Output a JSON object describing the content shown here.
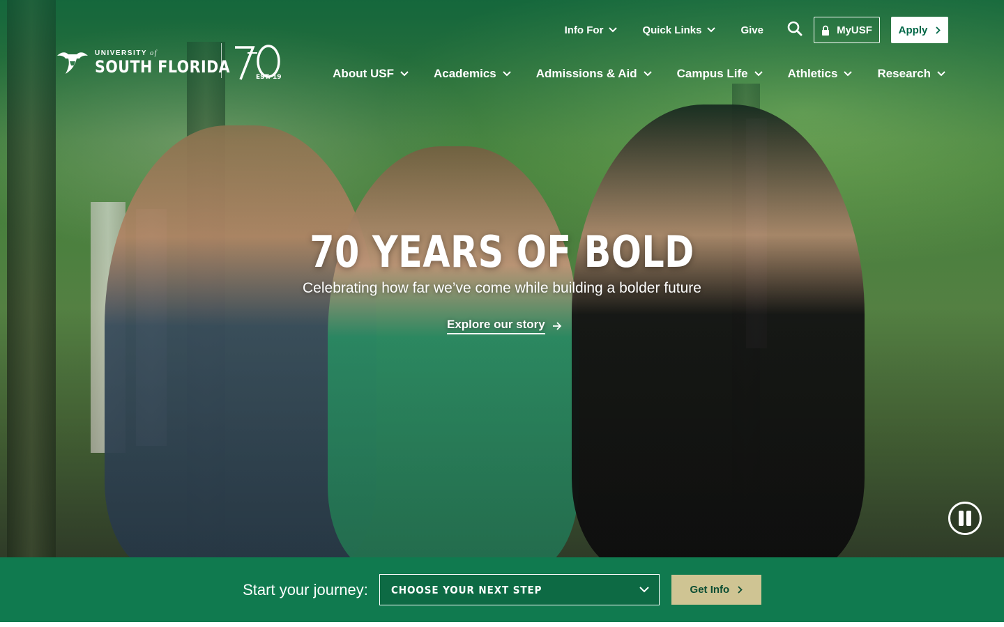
{
  "brand": {
    "university_small": "UNIVERSITY",
    "university_of": "of",
    "university_name": "SOUTH FLORIDA",
    "anniversary_number": "70",
    "anniversary_est": "EST. 1956"
  },
  "utility_nav": {
    "info_for": "Info For",
    "quick_links": "Quick Links",
    "give": "Give",
    "myusf": "MyUSF",
    "apply": "Apply"
  },
  "main_nav": {
    "items": [
      {
        "label": "About USF"
      },
      {
        "label": "Academics"
      },
      {
        "label": "Admissions & Aid"
      },
      {
        "label": "Campus Life"
      },
      {
        "label": "Athletics"
      },
      {
        "label": "Research"
      }
    ]
  },
  "hero": {
    "headline": "70 YEARS OF BOLD",
    "subhead": "Celebrating how far we’ve come while building a bolder future",
    "cta": "Explore our story"
  },
  "journey": {
    "label": "Start your journey:",
    "select_value": "CHOOSE YOUR NEXT STEP",
    "button": "Get Info"
  },
  "colors": {
    "usf_green": "#006747",
    "bar_green": "#107a4f",
    "sand": "#cfc493",
    "white": "#ffffff"
  },
  "icons": [
    "search-icon",
    "lock-icon",
    "chevron-down-icon",
    "chevron-right-icon",
    "arrow-right-icon",
    "pause-icon",
    "bull-logo-icon"
  ]
}
